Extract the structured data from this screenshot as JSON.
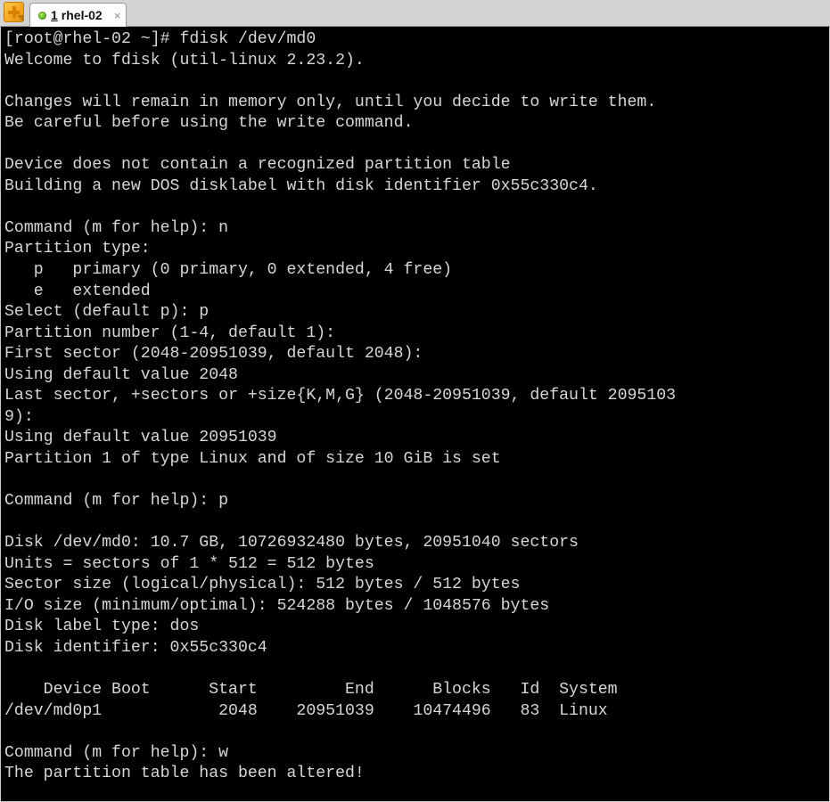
{
  "window": {
    "app_icon_name": "mobaxterm-plus-icon",
    "tab_bar_bg": "#d4d4d4",
    "terminal_bg": "#000000",
    "terminal_fg": "#d6d6d6"
  },
  "tab_bar": {
    "tabs": [
      {
        "index": "1",
        "title": "rhel-02",
        "close_label": "×",
        "status": "connected",
        "status_color": "#6fc329",
        "active": true
      }
    ]
  },
  "terminal": {
    "prompt": "[root@rhel-02 ~]#",
    "command": "fdisk /dev/md0",
    "lines": [
      "[root@rhel-02 ~]# fdisk /dev/md0",
      "Welcome to fdisk (util-linux 2.23.2).",
      "",
      "Changes will remain in memory only, until you decide to write them.",
      "Be careful before using the write command.",
      "",
      "Device does not contain a recognized partition table",
      "Building a new DOS disklabel with disk identifier 0x55c330c4.",
      "",
      "Command (m for help): n",
      "Partition type:",
      "   p   primary (0 primary, 0 extended, 4 free)",
      "   e   extended",
      "Select (default p): p",
      "Partition number (1-4, default 1):",
      "First sector (2048-20951039, default 2048):",
      "Using default value 2048",
      "Last sector, +sectors or +size{K,M,G} (2048-20951039, default 2095103",
      "9):",
      "Using default value 20951039",
      "Partition 1 of type Linux and of size 10 GiB is set",
      "",
      "Command (m for help): p",
      "",
      "Disk /dev/md0: 10.7 GB, 10726932480 bytes, 20951040 sectors",
      "Units = sectors of 1 * 512 = 512 bytes",
      "Sector size (logical/physical): 512 bytes / 512 bytes",
      "I/O size (minimum/optimal): 524288 bytes / 1048576 bytes",
      "Disk label type: dos",
      "Disk identifier: 0x55c330c4",
      "",
      "    Device Boot      Start         End      Blocks   Id  System",
      "/dev/md0p1            2048    20951039    10474496   83  Linux",
      "",
      "Command (m for help): w",
      "The partition table has been altered!"
    ],
    "session_facts": {
      "fdisk_version": "util-linux 2.23.2",
      "device": "/dev/md0",
      "disk_identifier": "0x55c330c4",
      "disk_label_type": "dos",
      "disk_size_human": "10.7 GB",
      "disk_size_bytes": "10726932480 bytes",
      "disk_sectors": "20951040 sectors",
      "units": "sectors of 1 * 512 = 512 bytes",
      "sector_size_logical_physical": "512 bytes / 512 bytes",
      "io_size_minimum_optimal": "524288 bytes / 1048576 bytes"
    },
    "partition_table": {
      "headers": [
        "Device",
        "Boot",
        "Start",
        "End",
        "Blocks",
        "Id",
        "System"
      ],
      "rows": [
        {
          "device": "/dev/md0p1",
          "boot": "",
          "start": "2048",
          "end": "20951039",
          "blocks": "10474496",
          "id": "83",
          "system": "Linux"
        }
      ]
    },
    "commands_entered": [
      "n",
      "p",
      "p",
      "w"
    ],
    "final_status": "The partition table has been altered!"
  }
}
